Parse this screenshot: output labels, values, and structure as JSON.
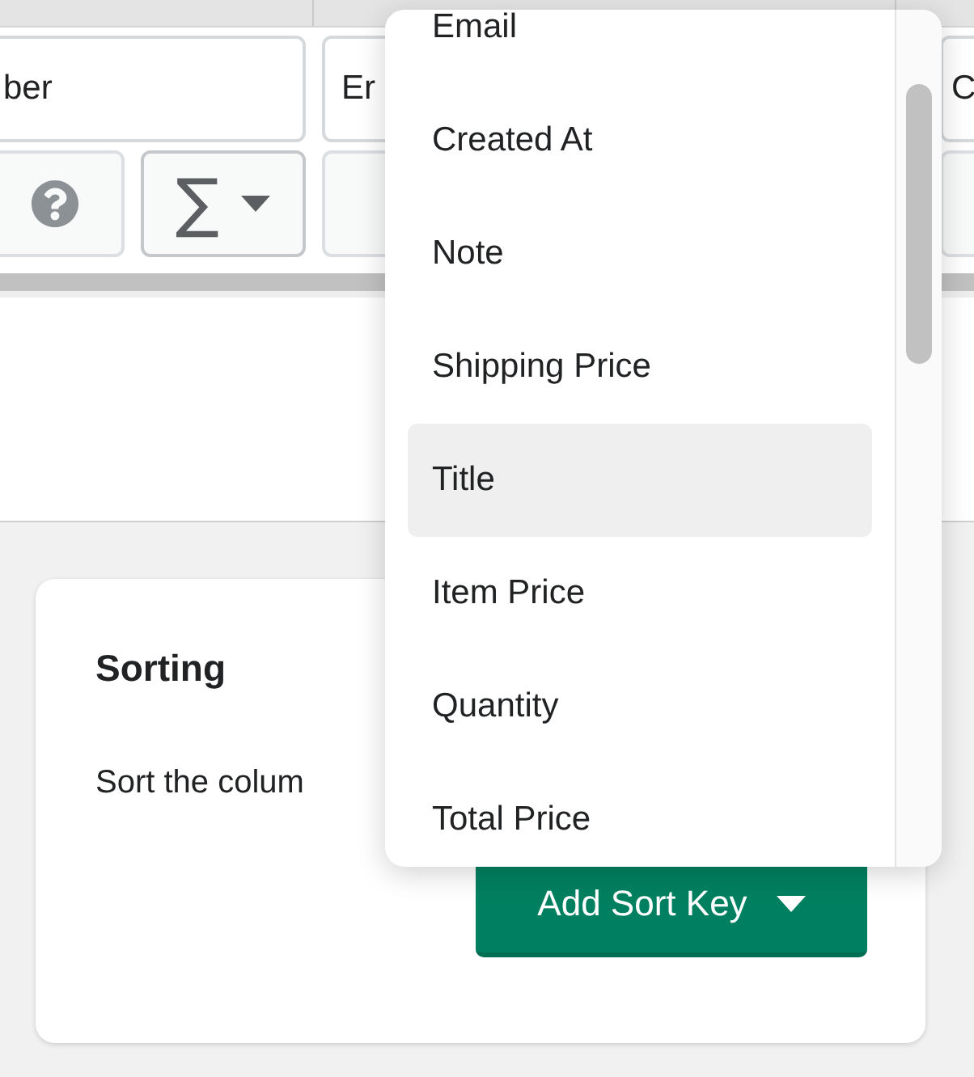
{
  "table": {
    "filter_fields": [
      {
        "value": "ber"
      },
      {
        "value": "Er"
      },
      {
        "value": "C"
      }
    ],
    "aggregate_button": {
      "label": "∑"
    }
  },
  "sorting": {
    "title": "Sorting",
    "description": "Sort the colum",
    "button": "Add Sort Key"
  },
  "dropdown": {
    "items": [
      {
        "label": "Email",
        "selected": false
      },
      {
        "label": "Created At",
        "selected": false
      },
      {
        "label": "Note",
        "selected": false
      },
      {
        "label": "Shipping Price",
        "selected": false
      },
      {
        "label": "Title",
        "selected": true
      },
      {
        "label": "Item Price",
        "selected": false
      },
      {
        "label": "Quantity",
        "selected": false
      },
      {
        "label": "Total Price",
        "selected": false
      }
    ]
  }
}
